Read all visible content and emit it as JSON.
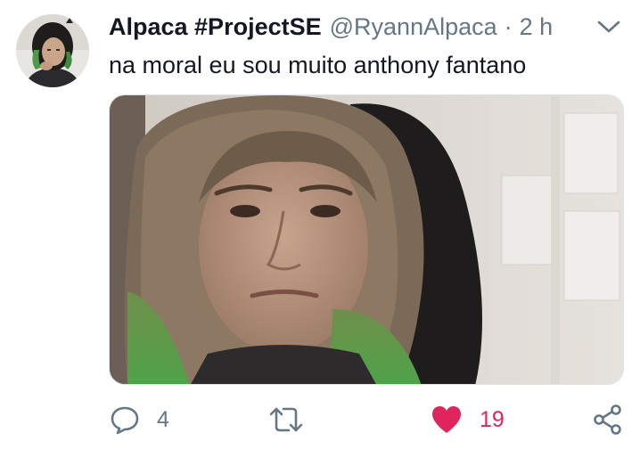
{
  "tweet": {
    "display_name": "Alpaca #ProjectSE",
    "handle": "@RyannAlpaca",
    "separator": "·",
    "timestamp": "2 h",
    "text": "na moral eu sou muito anthony fantano",
    "media_kind": "photo"
  },
  "actions": {
    "reply_count": "4",
    "like_count": "19",
    "liked": true
  },
  "icons": {
    "caret": "chevron-down-icon",
    "reply": "reply-icon",
    "retweet": "retweet-icon",
    "like": "heart-icon",
    "share": "share-icon"
  },
  "colors": {
    "text_primary": "#141823",
    "text_secondary": "#657786",
    "like_active": "#e0245e",
    "icon_default": "#657786"
  }
}
